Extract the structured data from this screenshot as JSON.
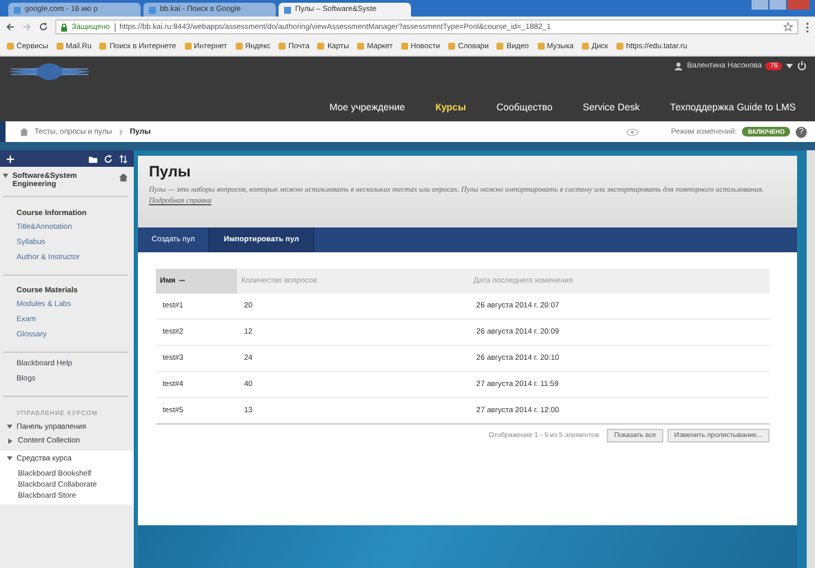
{
  "browser": {
    "tabs": [
      {
        "title": "google.com - 16 ию р",
        "selected": false
      },
      {
        "title": "bb.kai - Поиск в Google",
        "selected": false
      },
      {
        "title": "Пулы – Software&Syste",
        "selected": true
      }
    ],
    "secure_label": "Защищено",
    "url": "https://bb.kai.ru:8443/webapps/assessment/do/authoring/viewAssessmentManager?assessmentType=Pool&course_id=_1882_1",
    "bookmarks": [
      "Сервисы",
      "Mail.Ru",
      "Поиск в Интернете",
      "Интернет",
      "Яндекс",
      "Почта",
      "Карты",
      "Маркет",
      "Новости",
      "Словари",
      "Видео",
      "Музыка",
      "Диск",
      "https://edu.tatar.ru"
    ]
  },
  "header": {
    "user": "Валентина Насонова",
    "badge": "76",
    "nav": [
      {
        "label": "Мое учреждение",
        "selected": false
      },
      {
        "label": "Курсы",
        "selected": true
      },
      {
        "label": "Сообщество",
        "selected": false
      },
      {
        "label": "Service Desk",
        "selected": false
      },
      {
        "label": "Техподдержка Guide to LMS",
        "selected": false
      }
    ]
  },
  "breadcrumb": {
    "items": [
      "Тесты, опросы и пулы",
      "Пулы"
    ],
    "edit_mode_label": "Режим изменений:",
    "edit_mode": "ВКЛЮЧЕНО",
    "help": "?"
  },
  "sidebar": {
    "course": "Software&System Engineering",
    "groups": [
      {
        "heading": "Course Information",
        "items": [
          "Title&Annotation",
          "Syllabus",
          "Author & Instructor"
        ]
      },
      {
        "heading": "Course Materials",
        "items": [
          "Modules & Labs",
          "Exam",
          "Glossary"
        ]
      },
      {
        "items": [
          "Blackboard Help",
          "Blogs"
        ]
      }
    ],
    "management_heading": "УПРАВЛЕНИЕ КУРСОМ",
    "tree": [
      {
        "label": "Панель управления",
        "expanded": true
      },
      {
        "label": "Content Collection",
        "expanded": false
      },
      {
        "label": "Средства курса",
        "expanded": true,
        "children": [
          {
            "label": "Blackboard Bookshelf"
          },
          {
            "label": "Blackboard Collaborate"
          },
          {
            "label": "Blackboard Store"
          }
        ]
      }
    ]
  },
  "page": {
    "title": "Пулы",
    "description": "Пулы — это наборы вопросов, которые можно использовать в нескольких тестах или опросах. Пулы можно импортировать в систему или экспортировать для повторного использования.",
    "help_link": "Подробная справка",
    "actions": [
      "Создать пул",
      "Импортировать пул"
    ],
    "table": {
      "columns": [
        {
          "label": "Имя",
          "sorted": true
        },
        {
          "label": "Количество вопросов",
          "sorted": false
        },
        {
          "label": "Дата последнего изменения",
          "sorted": false
        }
      ],
      "rows": [
        [
          "test#1",
          "20",
          "26 августа 2014 г. 20:07"
        ],
        [
          "test#2",
          "12",
          "26 августа 2014 г. 20:09"
        ],
        [
          "test#3",
          "24",
          "26 августа 2014 г. 20:10"
        ],
        [
          "test#4",
          "40",
          "27 августа 2014 г. 11:59"
        ],
        [
          "test#5",
          "13",
          "27 августа 2014 г. 12:00"
        ]
      ]
    },
    "paging": {
      "summary": "Отображение 1 - 5 из 5 элементов",
      "buttons": [
        "Показать все",
        "Изменить пролистывание..."
      ]
    }
  }
}
